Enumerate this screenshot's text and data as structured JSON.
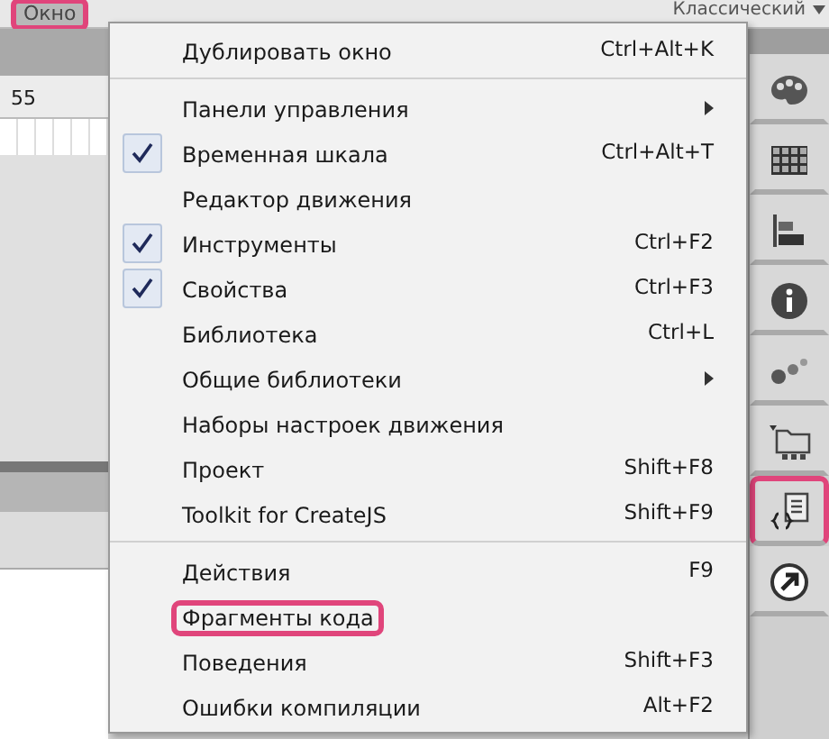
{
  "menu_bar": {
    "items": [
      {
        "label": "Окно",
        "annotated": true
      }
    ]
  },
  "workspace": {
    "label": "Классический"
  },
  "ruler": {
    "mark": "55"
  },
  "menu": {
    "groups": [
      [
        {
          "label": "Дублировать окно",
          "shortcut": "Ctrl+Alt+K",
          "checked": false,
          "submenu": false,
          "annotated": false
        }
      ],
      [
        {
          "label": "Панели управления",
          "checked": false,
          "submenu": true,
          "annotated": false
        },
        {
          "label": "Временная шкала",
          "shortcut": "Ctrl+Alt+T",
          "checked": true,
          "submenu": false,
          "annotated": false
        },
        {
          "label": "Редактор движения",
          "checked": false,
          "submenu": false,
          "annotated": false
        },
        {
          "label": "Инструменты",
          "shortcut": "Ctrl+F2",
          "checked": true,
          "submenu": false,
          "annotated": false
        },
        {
          "label": "Свойства",
          "shortcut": "Ctrl+F3",
          "checked": true,
          "submenu": false,
          "annotated": false
        },
        {
          "label": "Библиотека",
          "shortcut": "Ctrl+L",
          "checked": false,
          "submenu": false,
          "annotated": false
        },
        {
          "label": "Общие библиотеки",
          "checked": false,
          "submenu": true,
          "annotated": false
        },
        {
          "label": "Наборы настроек движения",
          "checked": false,
          "submenu": false,
          "annotated": false
        },
        {
          "label": "Проект",
          "shortcut": "Shift+F8",
          "checked": false,
          "submenu": false,
          "annotated": false
        },
        {
          "label": "Toolkit for CreateJS",
          "shortcut": "Shift+F9",
          "checked": false,
          "submenu": false,
          "annotated": false
        }
      ],
      [
        {
          "label": "Действия",
          "shortcut": "F9",
          "checked": false,
          "submenu": false,
          "annotated": false
        },
        {
          "label": "Фрагменты кода",
          "checked": false,
          "submenu": false,
          "annotated": true
        },
        {
          "label": "Поведения",
          "shortcut": "Shift+F3",
          "checked": false,
          "submenu": false,
          "annotated": false
        },
        {
          "label": "Ошибки компиляции",
          "shortcut": "Alt+F2",
          "checked": false,
          "submenu": false,
          "annotated": false
        }
      ]
    ]
  },
  "panel_dock": {
    "tools": [
      {
        "kind": "palette",
        "annotated": false
      },
      {
        "kind": "swatches",
        "annotated": false
      },
      {
        "kind": "align",
        "annotated": false
      },
      {
        "kind": "info",
        "annotated": false
      },
      {
        "kind": "presets",
        "annotated": false
      },
      {
        "kind": "library",
        "annotated": false
      },
      {
        "kind": "snippets",
        "annotated": true
      },
      {
        "kind": "behaviors",
        "annotated": false
      }
    ]
  }
}
